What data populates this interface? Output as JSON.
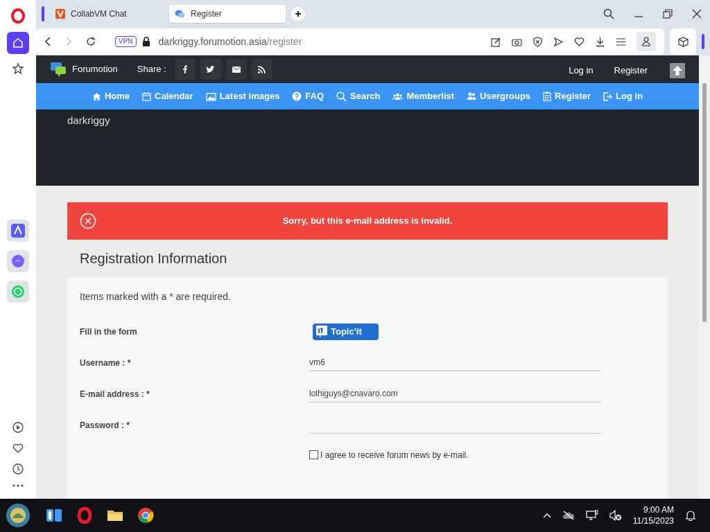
{
  "browser": {
    "tabs": [
      {
        "label": "CollabVM Chat",
        "selected": false
      },
      {
        "label": "Register",
        "selected": true
      }
    ],
    "vpn_badge": "VPN",
    "url_host": "darkriggy.forumotion.asia",
    "url_path": "/register"
  },
  "forum": {
    "brand": "Forumotion",
    "share_label": "Share :",
    "top_links": [
      "Log in",
      "Register"
    ],
    "nav": [
      {
        "label": "Home"
      },
      {
        "label": "Calendar"
      },
      {
        "label": "Latest images"
      },
      {
        "label": "FAQ"
      },
      {
        "label": "Search"
      },
      {
        "label": "Memberlist"
      },
      {
        "label": "Usergroups"
      },
      {
        "label": "Register"
      },
      {
        "label": "Log in"
      }
    ],
    "site_title": "darkriggy"
  },
  "error": "Sorry, but this e-mail address is invalid.",
  "form": {
    "title": "Registration Information",
    "note": "Items marked with a * are required.",
    "fill_label": "Fill in the form",
    "topicit_label": "Topic'it",
    "fields": [
      {
        "label": "Username : *",
        "value": "vm6"
      },
      {
        "label": "E-mail address : *",
        "value": "lolhiguys@cnavaro.com"
      },
      {
        "label": "Password : *"
      }
    ],
    "newsletter": {
      "label": "I agree to receive forum news by e-mail.",
      "checked": false
    }
  },
  "taskbar": {
    "time": "9:00 AM",
    "date": "11/15/2023"
  }
}
